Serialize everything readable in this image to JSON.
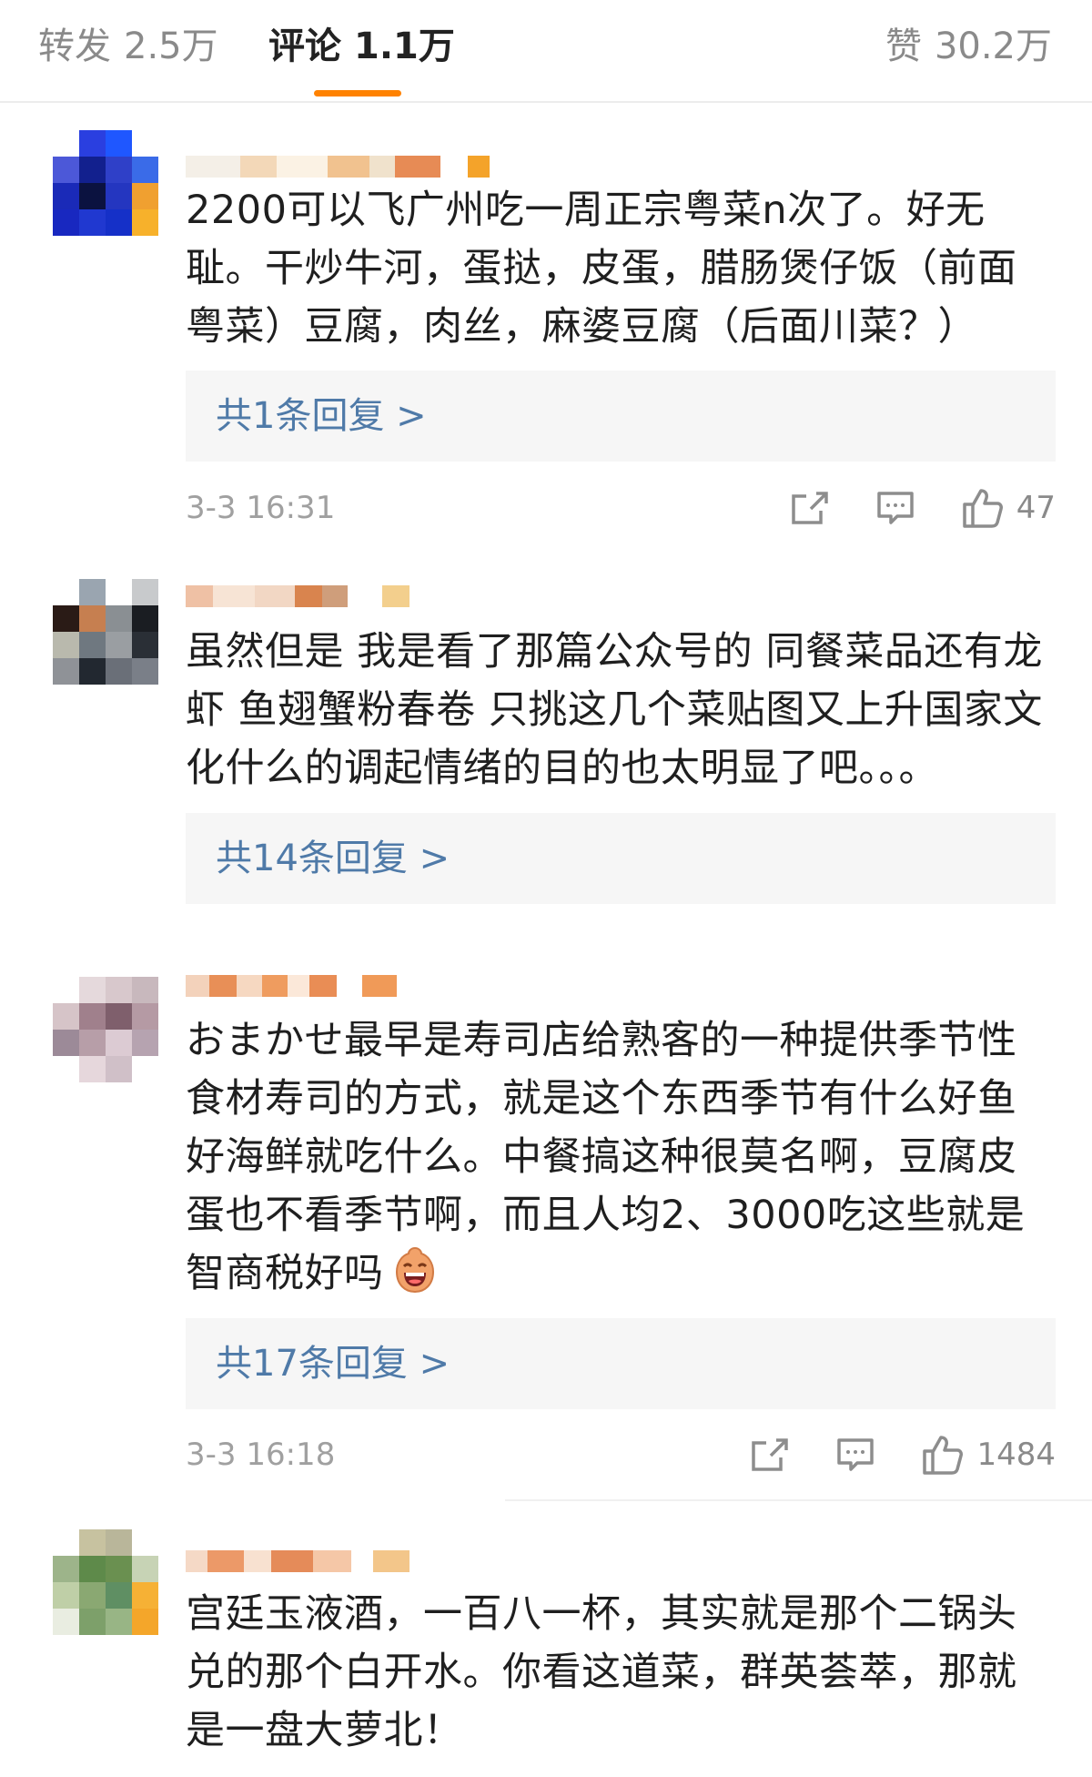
{
  "tabs": {
    "repost": {
      "label": "转发",
      "count": "2.5万"
    },
    "comments": {
      "label": "评论",
      "count": "1.1万"
    },
    "likes": {
      "label": "赞",
      "count": "30.2万"
    }
  },
  "accent_color": "#ff8200",
  "link_color": "#4f7aa8",
  "comments": [
    {
      "text": "2200可以飞广州吃一周正宗粤菜n次了。好无\n耻。干炒牛河，蛋挞，皮蛋，腊肠煲仔饭（前面\n粤菜）豆腐，肉丝，麻婆豆腐（后面川菜？）",
      "replies": "共1条回复 >",
      "time": "3-3 16:31",
      "likes": "47"
    },
    {
      "text": "虽然但是 我是看了那篇公众号的 同餐菜品还有龙\n虾 鱼翅蟹粉春卷 只挑这几个菜贴图又上升国家文\n化什么的调起情绪的目的也太明显了吧。。。",
      "replies": "共14条回复 >"
    },
    {
      "text": "おまかせ最早是寿司店给熟客的一种提供季节性\n食材寿司的方式，就是这个东西季节有什么好鱼\n好海鲜就吃什么。中餐搞这种很莫名啊，豆腐皮\n蛋也不看季节啊，而且人均2、3000吃这些就是\n智商税好吗",
      "replies": "共17条回复 >",
      "time": "3-3 16:18",
      "likes": "1484"
    },
    {
      "text": "宫廷玉液酒，一百八一杯，其实就是那个二锅头\n兑的那个白开水。你看这道菜，群英荟萃，那就\n是一盘大萝北！"
    }
  ]
}
